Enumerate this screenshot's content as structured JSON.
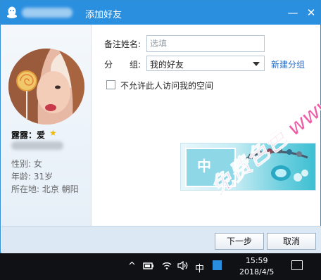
{
  "window": {
    "title": "添加好友",
    "minimize_label": "—",
    "close_label": "✕"
  },
  "profile": {
    "nickname": "露露：爱",
    "star": "★",
    "gender": "性别: 女",
    "age": "年龄: 31岁",
    "location": "所在地: 北京  朝阳"
  },
  "form": {
    "remark_label": "备注姓名:",
    "remark_placeholder": "选填",
    "group_label_1": "分",
    "group_label_2": "组:",
    "group_value": "我的好友",
    "new_group_link": "新建分组",
    "privacy_label": "不允许此人访问我的空间"
  },
  "banner": {
    "char": "中",
    "sub": "。"
  },
  "buttons": {
    "next": "下一步",
    "cancel": "取消"
  },
  "taskbar": {
    "ime": "中",
    "time": "15:59",
    "date": "2018/4/5"
  },
  "watermark": {
    "text": "免费色色 www.MFsese.com"
  },
  "colors": {
    "titlebar": "#2b8fe0",
    "link": "#2a6fc9",
    "watermark": "#f04fa0"
  }
}
